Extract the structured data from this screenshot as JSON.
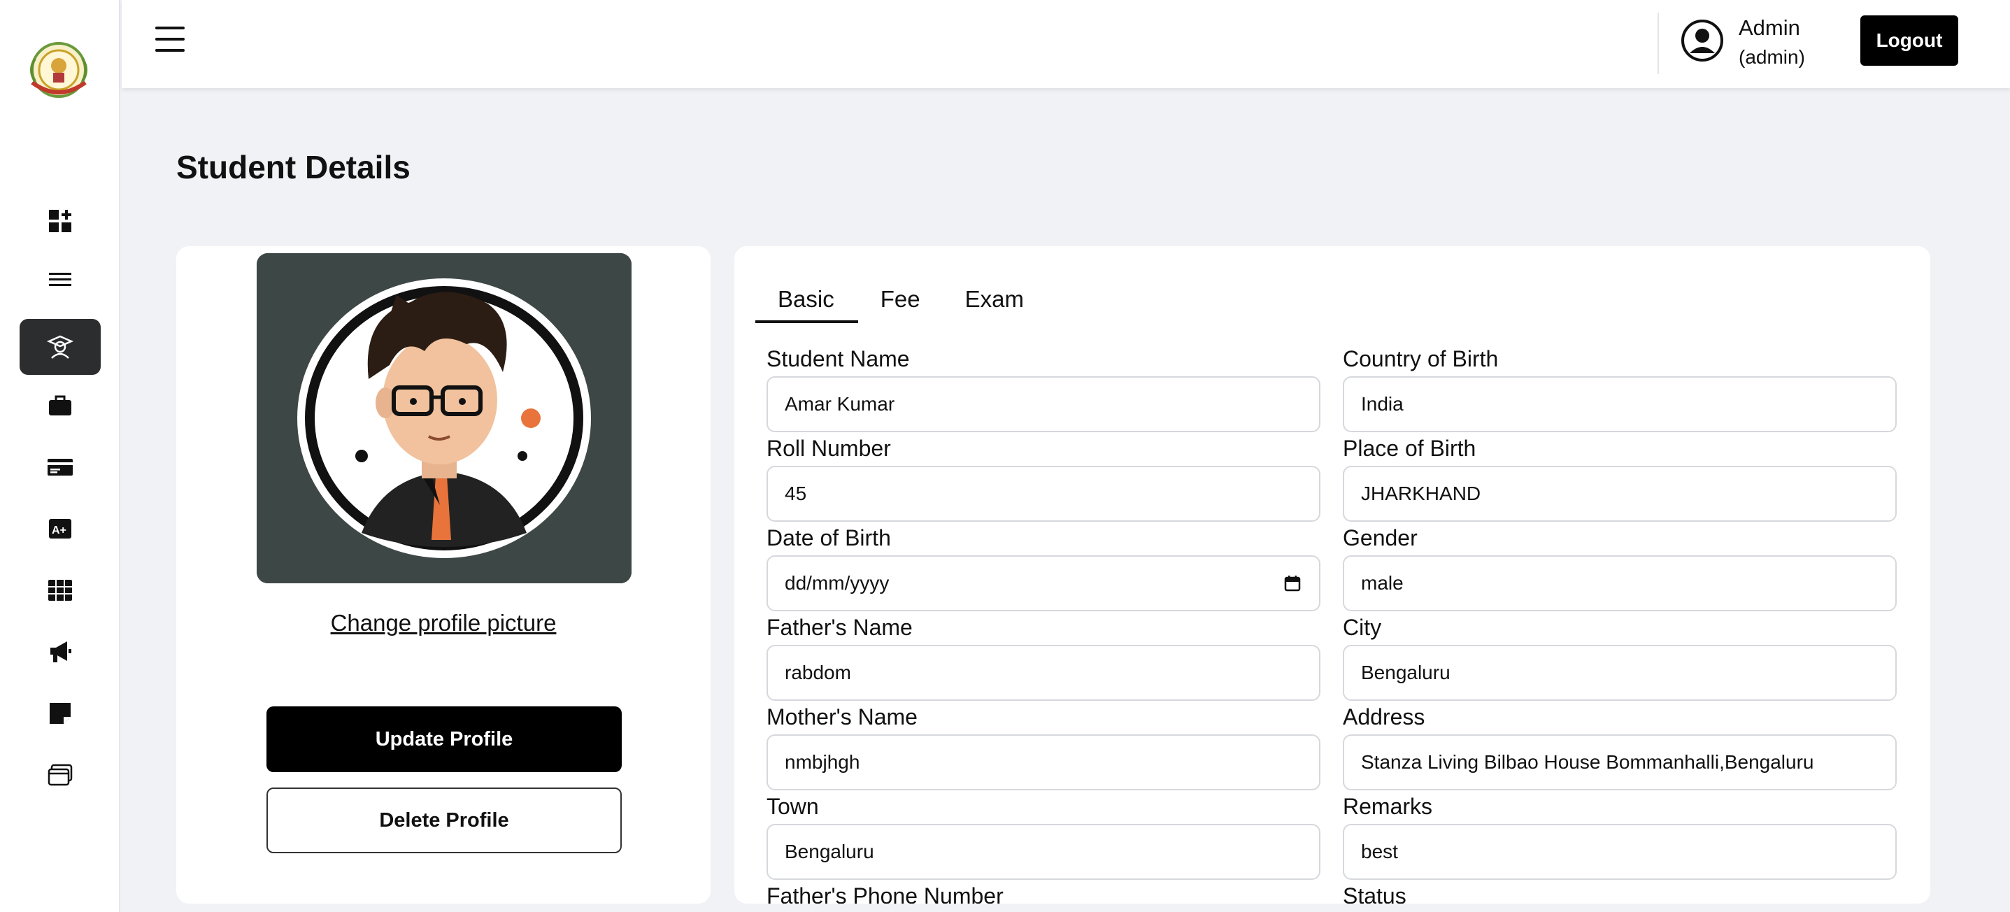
{
  "header": {
    "user_name": "Admin",
    "user_role": "(admin)",
    "logout_label": "Logout"
  },
  "sidebar": {
    "items": [
      {
        "icon": "dashboard-icon",
        "active": false
      },
      {
        "icon": "menu-lines-icon",
        "active": false
      },
      {
        "icon": "student-icon",
        "active": true
      },
      {
        "icon": "briefcase-icon",
        "active": false
      },
      {
        "icon": "payment-card-icon",
        "active": false
      },
      {
        "icon": "grade-icon",
        "active": false
      },
      {
        "icon": "table-grid-icon",
        "active": false
      },
      {
        "icon": "megaphone-icon",
        "active": false
      },
      {
        "icon": "sticky-note-icon",
        "active": false
      },
      {
        "icon": "browser-window-icon",
        "active": false
      }
    ]
  },
  "page": {
    "title": "Student Details"
  },
  "profile": {
    "change_picture": "Change profile picture",
    "update_label": "Update Profile",
    "delete_label": "Delete Profile"
  },
  "tabs": [
    "Basic",
    "Fee",
    "Exam"
  ],
  "form": {
    "student_name": {
      "label": "Student Name",
      "value": "Amar Kumar"
    },
    "country_of_birth": {
      "label": "Country of Birth",
      "value": "India"
    },
    "roll_number": {
      "label": "Roll Number",
      "value": "45"
    },
    "place_of_birth": {
      "label": "Place of Birth",
      "value": "JHARKHAND"
    },
    "date_of_birth": {
      "label": "Date of Birth",
      "value": "dd/mm/yyyy"
    },
    "gender": {
      "label": "Gender",
      "value": "male"
    },
    "fathers_name": {
      "label": "Father's Name",
      "value": "rabdom"
    },
    "city": {
      "label": "City",
      "value": "Bengaluru"
    },
    "mothers_name": {
      "label": "Mother's Name",
      "value": "nmbjhgh"
    },
    "address": {
      "label": "Address",
      "value": "Stanza Living Bilbao House Bommanhalli,Bengaluru"
    },
    "town": {
      "label": "Town",
      "value": "Bengaluru"
    },
    "remarks": {
      "label": "Remarks",
      "value": "best"
    },
    "fathers_phone": {
      "label": "Father's Phone Number"
    },
    "status": {
      "label": "Status"
    }
  },
  "colors": {
    "background": "#f1f2f6",
    "primary_button": "#000000",
    "active_nav": "#2b2d2f",
    "avatar_bg": "#3d4745",
    "accent_orange": "#e8743b"
  }
}
